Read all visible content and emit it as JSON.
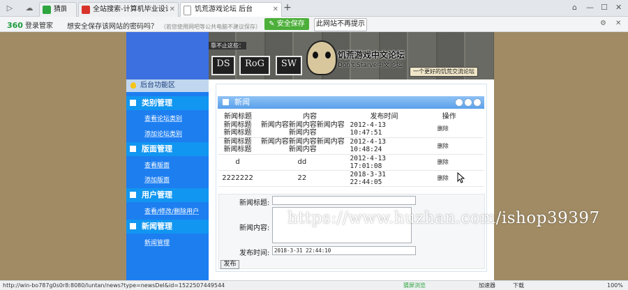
{
  "browser": {
    "tabs": [
      {
        "label": "猜屏浏览",
        "icon": "green-square-icon",
        "color": "#2fa63f"
      },
      {
        "label": "全站搜索-计算机毕业设计_计算机",
        "icon": "red-square-icon",
        "color": "#d9342b"
      },
      {
        "label": "饥荒游戏论坛 后台",
        "icon": "page-icon",
        "color": "#ffffff"
      }
    ],
    "new_tab": "+"
  },
  "password_bar": {
    "brand": "360",
    "brand_suffix": "登录管家",
    "question": "想安全保存该网站的密码吗？",
    "note": "（若您使用网吧等公共电脑不建议保存）",
    "save_button": "安全保存",
    "never_button": "此网站不再提示"
  },
  "banner": {
    "tagline": "靠不止这些：",
    "signs": [
      "DS",
      "RoG",
      "SW"
    ],
    "title": "饥荒游戏中文论坛",
    "subtitle": "Don't Starve中文论坛",
    "slogan": "一个更好的饥荒交流论坛"
  },
  "sidebar": {
    "current": "后台功能区",
    "groups": [
      {
        "title": "类别管理",
        "items": [
          "查看论坛类别",
          "添加论坛类别"
        ]
      },
      {
        "title": "版面管理",
        "items": [
          "查看版面",
          "添加版面"
        ]
      },
      {
        "title": "用户管理",
        "items": [
          "查看/修改/删除用户"
        ]
      },
      {
        "title": "新闻管理",
        "items": [
          "新闻管理"
        ]
      }
    ]
  },
  "panel": {
    "title": "新闻",
    "columns": [
      "新闻标题",
      "内容",
      "发布时间",
      "操作"
    ],
    "rows": [
      {
        "title": "新闻标题 新闻标题",
        "content": "新闻内容新闻内容新闻内容新闻内容",
        "time": "2012-4-13 10:47:51",
        "action": "删除"
      },
      {
        "title": "新闻标题 新闻标题",
        "content": "新闻内容新闻内容新闻内容新闻内容",
        "time": "2012-4-13 10:48:24",
        "action": "删除"
      },
      {
        "title": "d",
        "content": "dd",
        "time": "2012-4-13 17:01:08",
        "action": "删除"
      },
      {
        "title": "2222222",
        "content": "22",
        "time": "2018-3-31 22:44:05",
        "action": "删除"
      }
    ]
  },
  "form": {
    "title_label": "新闻标题:",
    "title_value": "",
    "content_label": "新闻内容:",
    "time_label": "发布时间:",
    "time_value": "2018-3-31 22:44:10",
    "submit": "发布"
  },
  "watermark": "https://www.huzhan.com/ishop39397",
  "status": {
    "url": "http://win-bo787g0s0r8:8080/luntan/news?type=newsDel&id=1522507449544",
    "items": [
      "猜屏浏览",
      "加速器",
      "下载",
      "100%"
    ]
  }
}
